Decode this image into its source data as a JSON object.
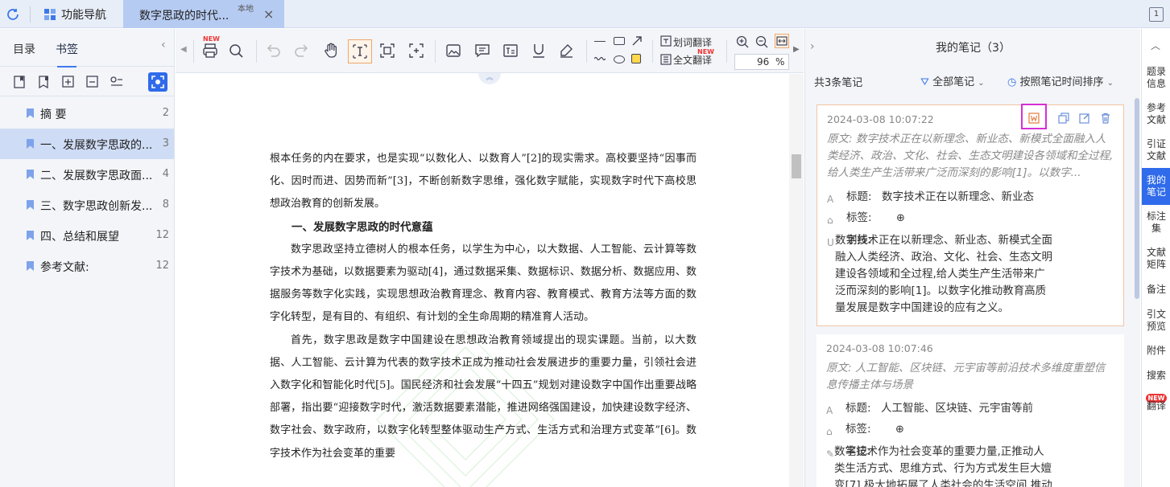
{
  "titlebar": {
    "nav_label": "功能导航",
    "doc_tab": "数字思政的时代...",
    "doc_badge": "本地",
    "close": "×",
    "right_btn": "1"
  },
  "left": {
    "tabs": [
      "目录",
      "书签"
    ],
    "bookmarks": [
      {
        "label": "摘 要",
        "page": "2"
      },
      {
        "label": "一、发展数字思政的...",
        "page": "3"
      },
      {
        "label": "二、发展数字思政面...",
        "page": "4"
      },
      {
        "label": "三、数字思政创新发...",
        "page": "8"
      },
      {
        "label": "四、总结和展望",
        "page": "12"
      },
      {
        "label": "参考文献:",
        "page": "12"
      }
    ]
  },
  "toolbar": {
    "new1": "NEW",
    "new2": "NEW",
    "word_translate": "划词翻译",
    "full_translate": "全文翻译",
    "zoom_value": "96",
    "zoom_unit": "%"
  },
  "document": {
    "paragraphs": [
      {
        "type": "noind",
        "text": "根本任务的内在要求，也是实现“以数化人、以数育人”[2]的现实需求。高校要坚持“因事而化、因时而进、因势而新”[3]，不断创新数字思维，强化数字赋能，实现数字时代下高校思想政治教育的创新发展。"
      },
      {
        "type": "heading",
        "text": "一、发展数字思政的时代意蕴"
      },
      {
        "type": "para",
        "text": "数字思政坚持立德树人的根本任务，以学生为中心，以大数据、人工智能、云计算等数字技术为基础，以数据要素为驱动[4]，通过数据采集、数据标识、数据分析、数据应用、数据服务等数字化实践，实现思想政治教育理念、教育内容、教育模式、教育方法等方面的数字化转型，是有目的、有组织、有计划的全生命周期的精准育人活动。"
      },
      {
        "type": "para",
        "text": "首先，数字思政是数字中国建设在思想政治教育领域提出的现实课题。当前，以大数据、人工智能、云计算为代表的数字技术正成为推动社会发展进步的重要力量，引领社会进入数字化和智能化时代[5]。国民经济和社会发展“十四五”规划对建设数字中国作出重要战略部署，指出要“迎接数字时代，激活数据要素潜能，推进网络强国建设，加快建设数字经济、数字社会、数字政府，以数字化转型整体驱动生产方式、生活方式和治理方式变革”[6]。数字技术作为社会变革的重要"
      }
    ]
  },
  "notes": {
    "title": "我的笔记（3）",
    "count": "共3条笔记",
    "filter": "全部笔记",
    "sort": "按照笔记时间排序",
    "cards": [
      {
        "time": "2024-03-08 10:07:22",
        "orig": "原文: 数字技术正在以新理念、新业态、新模式全面融入人类经济、政治、文化、社会、生态文明建设各领域和全过程,给人类生产生活带来广泛而深刻的影响[1]。以数字...",
        "title_k": "标题:",
        "title_v": "数字技术正在以新理念、新业态",
        "tag_k": "标签:",
        "mark_k": "划线:",
        "mark_v": "数字技术正在以新理念、新业态、新模式全面融入人类经济、政治、文化、社会、生态文明建设各领域和全过程,给人类生产生活带来广泛而深刻的影响[1]。以数字化推动教育高质量发展是数字中国建设的应有之义。"
      },
      {
        "time": "2024-03-08 10:07:46",
        "orig": "原文: 人工智能、区块链、元宇宙等前沿技术多维度重塑信息传播主体与场景",
        "title_k": "标题:",
        "title_v": "人工智能、区块链、元宇宙等前",
        "tag_k": "标签:",
        "note_k": "笔记:",
        "note_v": "数字技术作为社会变革的重要力量,正推动人类生活方式、思维方式、行为方式发生巨大嬗变[7],极大地拓展了人类社会的生活空间,推动全社会领域的数字革"
      }
    ]
  },
  "rail": {
    "items": [
      "题录信息",
      "参考文献",
      "引证文献",
      "我的笔记",
      "标注集",
      "文献矩阵",
      "备注",
      "引文预览",
      "附件",
      "搜索",
      "翻译"
    ],
    "new_badge": "NEW"
  },
  "colors": {
    "accent": "#2f6bea",
    "tab_active": "#b6cbf2",
    "highlight_box": "#d72fd4"
  }
}
